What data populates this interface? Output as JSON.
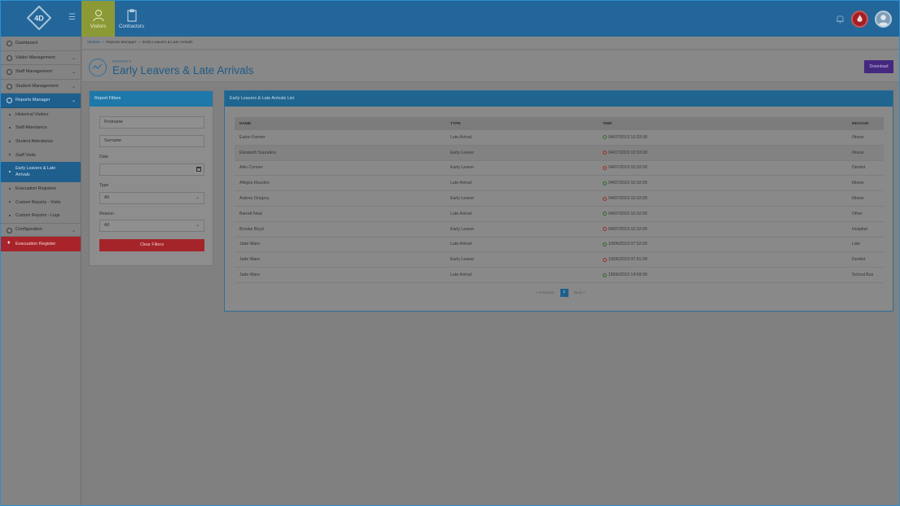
{
  "topbar": {
    "logo_text": "4D",
    "nav": [
      {
        "label": "Visitors",
        "icon": "visitor-icon",
        "active": true
      },
      {
        "label": "Contractors",
        "icon": "clipboard-icon",
        "active": false
      }
    ],
    "colors": {
      "bar": "#23669a",
      "active_tab": "#8b9a36",
      "fire": "#a21f24"
    }
  },
  "sidebar": {
    "items": [
      {
        "label": "Dashboard",
        "icon": "dashboard-icon"
      },
      {
        "label": "Visitor Management",
        "icon": "visitor-icon"
      },
      {
        "label": "Staff Management",
        "icon": "staff-icon"
      },
      {
        "label": "Student Management",
        "icon": "student-icon"
      },
      {
        "label": "Reports Manager",
        "icon": "reports-icon"
      }
    ],
    "subitems": [
      "Historical Visitors",
      "Staff Attendance",
      "Student Attendance",
      "Staff Visits",
      "Early Leavers & Late Arrivals",
      "Evacuation Registers",
      "Custom Reports - Visits",
      "Custom Reports - Logs"
    ],
    "configuration": "Configuration",
    "evacuation": "Evacuation Register"
  },
  "breadcrumb": {
    "items": [
      "Visitors",
      "Reports Manager",
      "Early Leavers & Late Arrivals"
    ]
  },
  "header": {
    "kicker": "REPORTS",
    "title": "Early Leavers & Late Arrivals",
    "download": "Download"
  },
  "filters": {
    "title": "Report Filters",
    "firstname_placeholder": "Firstname",
    "surname_placeholder": "Surname",
    "date_label": "Date",
    "date_value": "",
    "type_label": "Type",
    "type_value": "All",
    "reason_label": "Reason",
    "reason_value": "All",
    "clear": "Clear Filters"
  },
  "list": {
    "title": "Early Leavers & Late Arrivals List",
    "columns": [
      "NAME",
      "TYPE",
      "TIME",
      "REASON"
    ],
    "rows": [
      {
        "name": "Eaton Farmer",
        "type": "Late Arrival",
        "time": "04/07/2019 10:33:00",
        "reason": "Illness"
      },
      {
        "name": "Elizabeth Saunders",
        "type": "Early Leaver",
        "time": "04/07/2019 10:33:00",
        "reason": "Illness"
      },
      {
        "name": "Aiko Conner",
        "type": "Early Leaver",
        "time": "04/07/2019 10:32:00",
        "reason": "Dentist"
      },
      {
        "name": "Allegra Houston",
        "type": "Late Arrival",
        "time": "04/07/2019 10:32:00",
        "reason": "Illness"
      },
      {
        "name": "Aubrey Gregory",
        "type": "Early Leaver",
        "time": "04/07/2019 10:32:00",
        "reason": "Illness"
      },
      {
        "name": "Barrett Neal",
        "type": "Late Arrival",
        "time": "04/07/2019 10:32:00",
        "reason": "Other"
      },
      {
        "name": "Brooke Boyd",
        "type": "Early Leaver",
        "time": "04/07/2019 10:32:00",
        "reason": "Hospital"
      },
      {
        "name": "Jade Ware",
        "type": "Late Arrival",
        "time": "19/06/2019 07:52:00",
        "reason": "Late"
      },
      {
        "name": "Jade Ware",
        "type": "Early Leaver",
        "time": "19/06/2019 07:51:00",
        "reason": "Dentist"
      },
      {
        "name": "Jade Ware",
        "type": "Late Arrival",
        "time": "18/06/2019 14:59:00",
        "reason": "School Bus"
      }
    ],
    "pager": {
      "previous": "Previous",
      "page": "1",
      "next": "Next"
    }
  }
}
